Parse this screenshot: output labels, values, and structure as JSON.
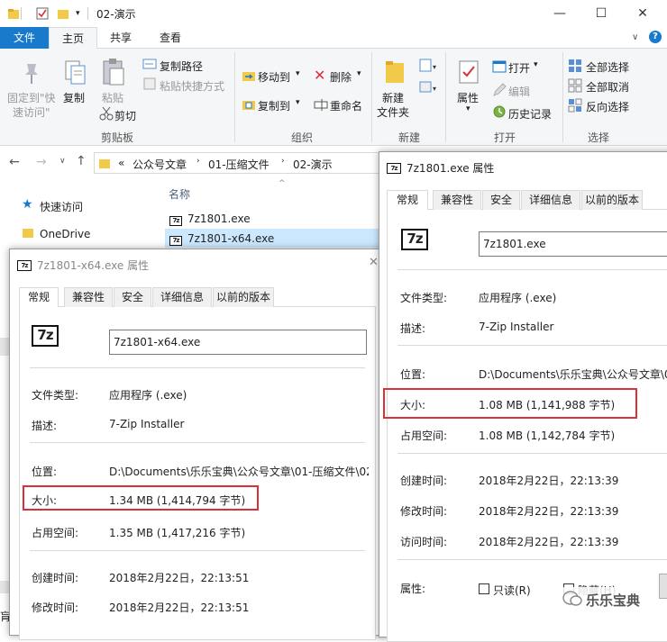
{
  "window": {
    "title": "02-演示"
  },
  "tabs": {
    "file": "文件",
    "home": "主页",
    "share": "共享",
    "view": "查看"
  },
  "ribbon": {
    "pin": "固定到\"快\n速访问\"",
    "pin_l1": "固定到\"快",
    "pin_l2": "速访问\"",
    "copy": "复制",
    "paste": "粘贴",
    "copy_path": "复制路径",
    "paste_shortcut": "粘贴快捷方式",
    "cut": "剪切",
    "group_clipboard": "剪贴板",
    "move_to": "移动到",
    "copy_to": "复制到",
    "delete": "删除",
    "rename": "重命名",
    "group_organize": "组织",
    "new_folder_l1": "新建",
    "new_folder_l2": "文件夹",
    "group_new": "新建",
    "properties": "属性",
    "open": "打开",
    "edit": "编辑",
    "history": "历史记录",
    "group_open": "打开",
    "select_all": "全部选择",
    "select_none": "全部取消",
    "invert": "反向选择",
    "group_select": "选择"
  },
  "address": {
    "prefix": "«",
    "crumbs": [
      "公众号文章",
      "01-压缩文件",
      "02-演示"
    ]
  },
  "nav": {
    "quick_access": "快速访问",
    "onedrive": "OneDrive"
  },
  "filelist": {
    "header": "名称",
    "files": [
      "7z1801.exe",
      "7z1801-x64.exe"
    ]
  },
  "dialog_left": {
    "title": "7z1801-x64.exe 属性",
    "tabs": [
      "常规",
      "兼容性",
      "安全",
      "详细信息",
      "以前的版本"
    ],
    "name": "7z1801-x64.exe",
    "icon_text": "7z",
    "type_label": "文件类型:",
    "type_value": "应用程序 (.exe)",
    "desc_label": "描述:",
    "desc_value": "7-Zip Installer",
    "loc_label": "位置:",
    "loc_value": "D:\\Documents\\乐乐宝典\\公众号文章\\01-压缩文件\\02",
    "size_label": "大小:",
    "size_value": "1.34 MB (1,414,794 字节)",
    "disk_label": "占用空间:",
    "disk_value": "1.35 MB (1,417,216 字节)",
    "created_label": "创建时间:",
    "created_value": "2018年2月22日，22:13:51",
    "modified_label": "修改时间:",
    "modified_value": "2018年2月22日，22:13:51"
  },
  "dialog_right": {
    "title": "7z1801.exe 属性",
    "tabs": [
      "常规",
      "兼容性",
      "安全",
      "详细信息",
      "以前的版本"
    ],
    "name": "7z1801.exe",
    "icon_text": "7z",
    "type_label": "文件类型:",
    "type_value": "应用程序 (.exe)",
    "desc_label": "描述:",
    "desc_value": "7-Zip Installer",
    "loc_label": "位置:",
    "loc_value": "D:\\Documents\\乐乐宝典\\公众号文章\\0",
    "size_label": "大小:",
    "size_value": "1.08 MB (1,141,988 字节)",
    "disk_label": "占用空间:",
    "disk_value": "1.08 MB (1,142,784 字节)",
    "created_label": "创建时间:",
    "created_value": "2018年2月22日，22:13:39",
    "modified_label": "修改时间:",
    "modified_value": "2018年2月22日，22:13:39",
    "accessed_label": "访问时间:",
    "accessed_value": "2018年2月22日，22:13:39",
    "attr_label": "属性:",
    "readonly": "只读(R)",
    "hidden": "隐藏(H)"
  },
  "watermark": "乐乐宝典",
  "edge_char": "肓",
  "colors": {
    "accent": "#1979ca",
    "highlight": "#d9303a",
    "ribbon_bg": "#f5f6f7"
  }
}
